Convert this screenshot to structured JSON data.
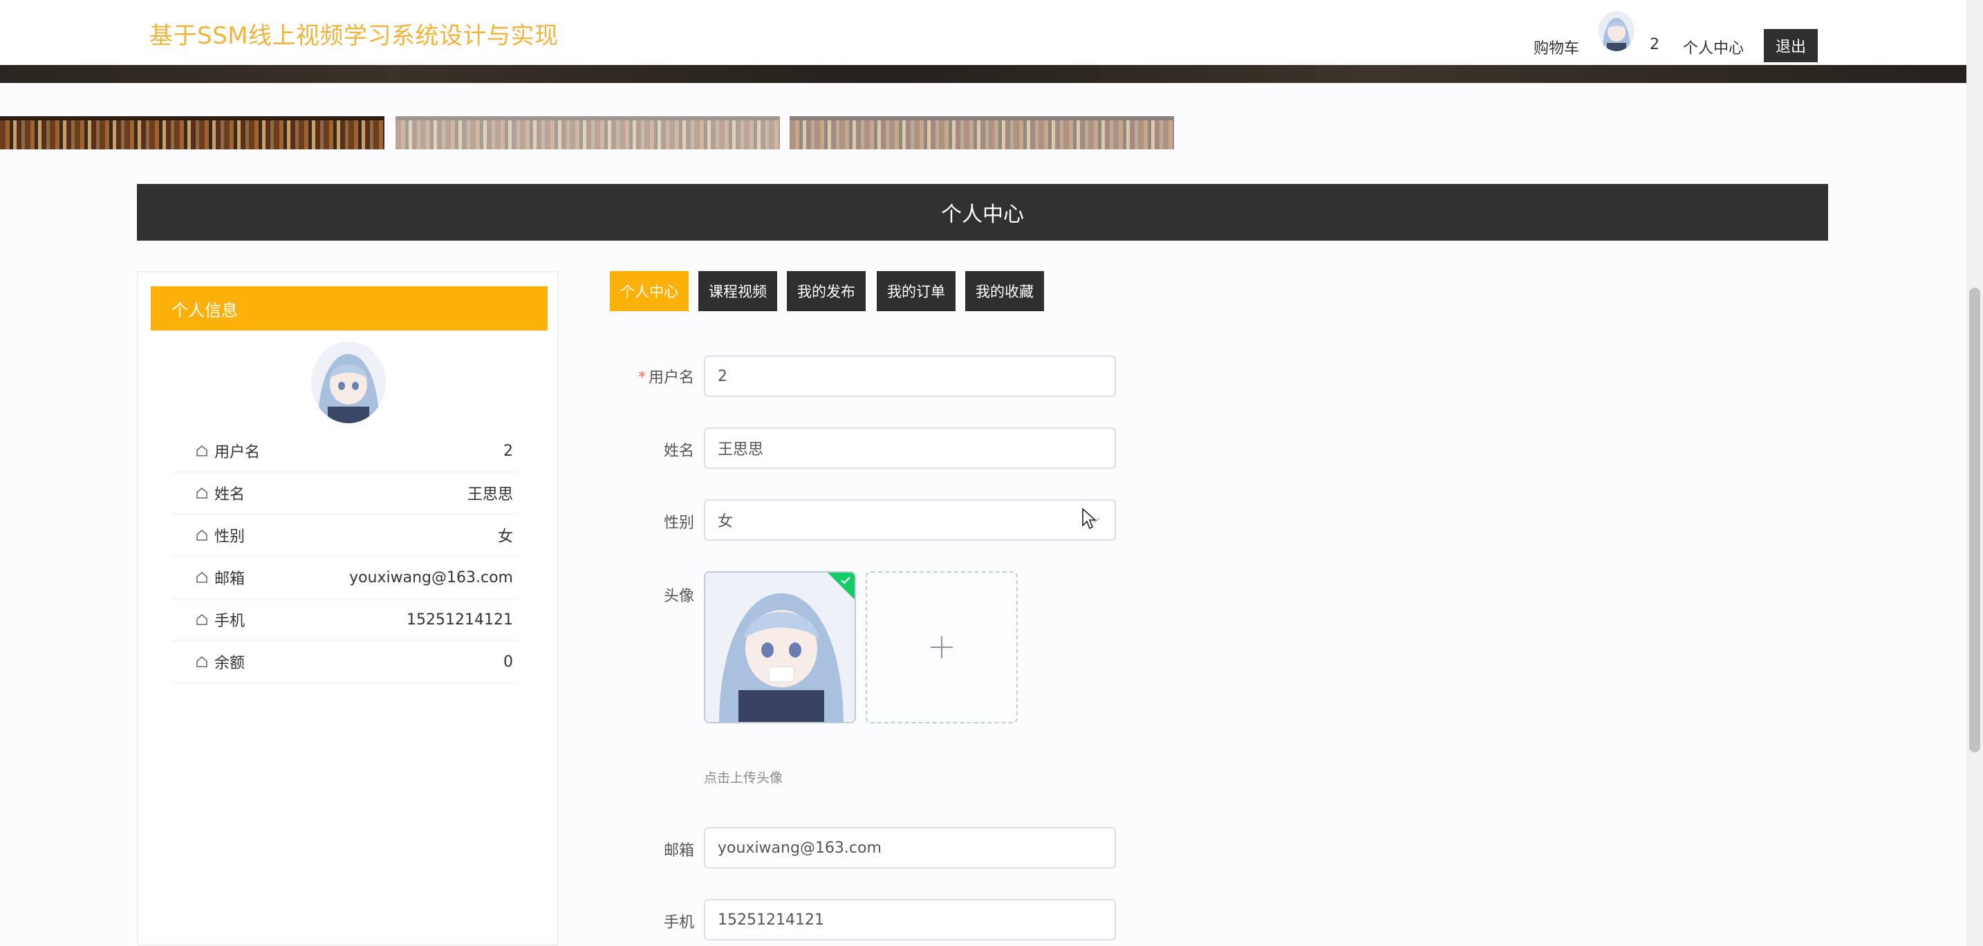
{
  "header": {
    "site_title": "基于SSM线上视频学习系统设计与实现",
    "cart_label": "购物车",
    "username": "2",
    "center_label": "个人中心",
    "logout_label": "退出"
  },
  "section": {
    "title": "个人中心"
  },
  "profile_card": {
    "title": "个人信息",
    "items": [
      {
        "label": "用户名",
        "value": "2"
      },
      {
        "label": "姓名",
        "value": "王思思"
      },
      {
        "label": "性别",
        "value": "女"
      },
      {
        "label": "邮箱",
        "value": "youxiwang@163.com"
      },
      {
        "label": "手机",
        "value": "15251214121"
      },
      {
        "label": "余额",
        "value": "0"
      }
    ]
  },
  "tabs": [
    {
      "label": "个人中心",
      "active": true
    },
    {
      "label": "课程视频",
      "active": false
    },
    {
      "label": "我的发布",
      "active": false
    },
    {
      "label": "我的订单",
      "active": false
    },
    {
      "label": "我的收藏",
      "active": false
    }
  ],
  "form": {
    "username": {
      "label": "用户名",
      "required_mark": "*",
      "value": "2"
    },
    "name": {
      "label": "姓名",
      "value": "王思思"
    },
    "gender": {
      "label": "性别",
      "value": "女"
    },
    "avatar": {
      "label": "头像",
      "hint": "点击上传头像"
    },
    "email": {
      "label": "邮箱",
      "value": "youxiwang@163.com"
    },
    "phone": {
      "label": "手机",
      "value": "15251214121"
    }
  },
  "colors": {
    "accent": "#fcb00a",
    "title": "#f0b43c",
    "dark": "#2f2f2f",
    "success": "#13ce66"
  },
  "icons": {
    "home": "home-icon",
    "plus": "plus-icon",
    "check": "check-icon",
    "chevron": "chevron-down-icon",
    "cursor": "mouse-cursor-icon"
  }
}
